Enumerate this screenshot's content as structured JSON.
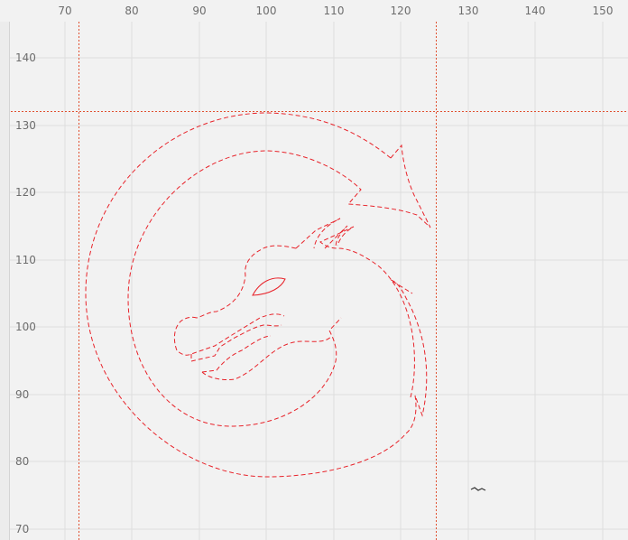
{
  "ruler": {
    "x_ticks": [
      "70",
      "80",
      "90",
      "100",
      "110",
      "120",
      "130",
      "140",
      "150"
    ],
    "y_ticks": [
      "140",
      "130",
      "120",
      "110",
      "100",
      "90",
      "80",
      "70"
    ]
  },
  "guides": {
    "vertical_x": [
      72.4,
      125.6
    ],
    "horizontal_y": [
      132.1
    ]
  },
  "colors": {
    "background": "#f2f2f2",
    "grid": "#dedede",
    "guide": "#e05030",
    "path": "#e8232a",
    "tick_text": "#6d6d6d"
  },
  "shape": {
    "name": "dragon-logo",
    "stroke_style": "dashed"
  }
}
